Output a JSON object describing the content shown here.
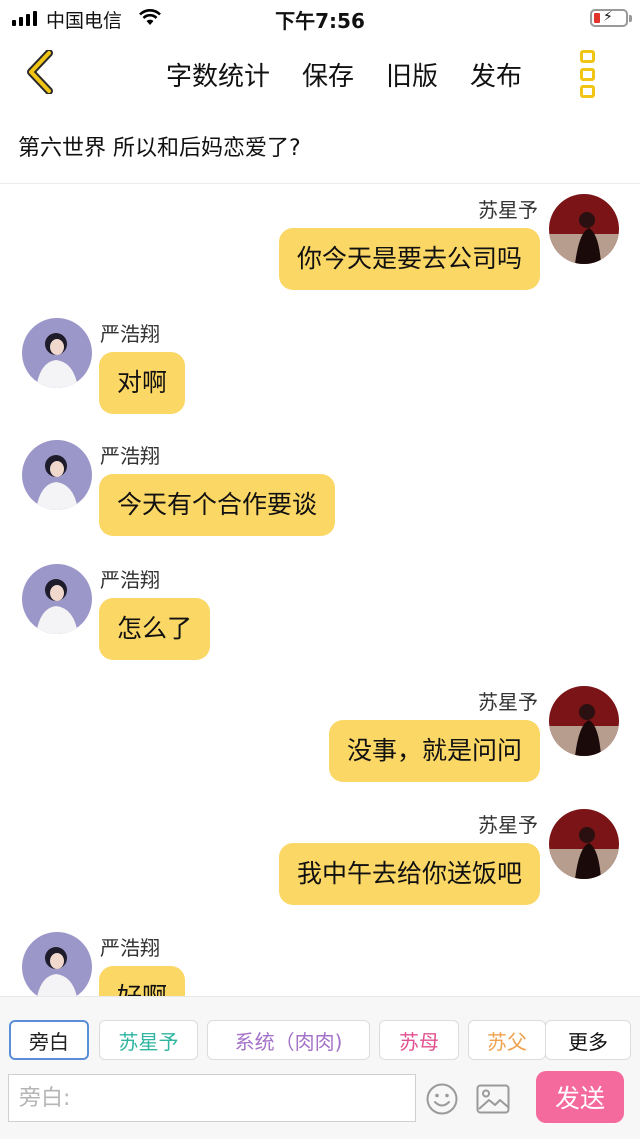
{
  "status_bar": {
    "carrier": "中国电信",
    "time": "下午7:56"
  },
  "nav": {
    "actions": [
      "字数统计",
      "保存",
      "旧版",
      "发布"
    ]
  },
  "chapter": {
    "title": "第六世界  所以和后妈恋爱了?"
  },
  "messages": [
    {
      "side": "right",
      "sender": "苏星予",
      "text": "你今天是要去公司吗"
    },
    {
      "side": "left",
      "sender": "严浩翔",
      "text": "对啊"
    },
    {
      "side": "left",
      "sender": "严浩翔",
      "text": "今天有个合作要谈"
    },
    {
      "side": "left",
      "sender": "严浩翔",
      "text": "怎么了"
    },
    {
      "side": "right",
      "sender": "苏星予",
      "text": "没事，就是问问"
    },
    {
      "side": "right",
      "sender": "苏星予",
      "text": "我中午去给你送饭吧"
    },
    {
      "side": "left",
      "sender": "严浩翔",
      "text": "好啊"
    }
  ],
  "roles": [
    {
      "label": "旁白",
      "color": "#222222"
    },
    {
      "label": "苏星予",
      "color": "#2fb5a0"
    },
    {
      "label": "系统（肉肉)",
      "color": "#a573c9"
    },
    {
      "label": "苏母",
      "color": "#e2518f"
    },
    {
      "label": "苏父",
      "color": "#f0a24f"
    },
    {
      "label": "更多",
      "color": "#111111"
    }
  ],
  "composer": {
    "placeholder": "旁白:",
    "send_label": "发送"
  },
  "colors": {
    "bubble": "#fbd766",
    "accent_yellow": "#f1c514",
    "send_button": "#f56a9c",
    "active_chip_border": "#5a8fd8"
  },
  "icons": [
    "signal-icon",
    "wifi-icon",
    "battery-icon",
    "back-chevron-icon",
    "more-menu-icon",
    "emoji-icon",
    "image-icon"
  ]
}
